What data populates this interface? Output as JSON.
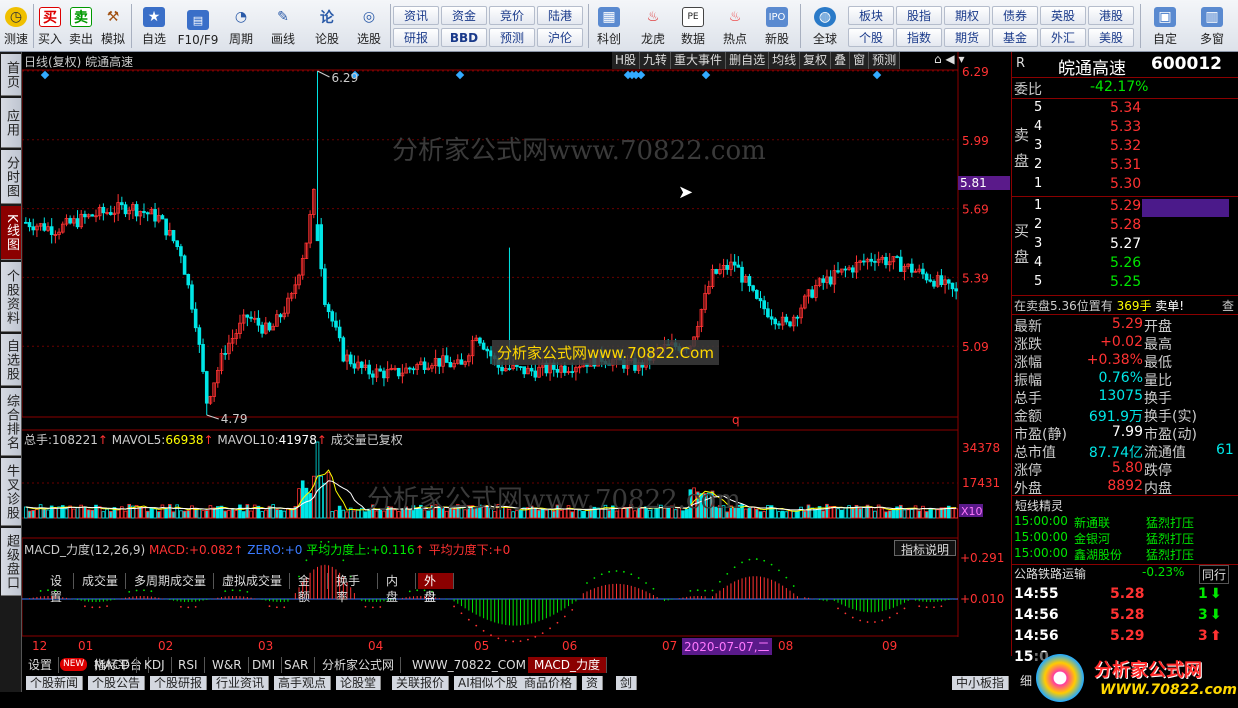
{
  "toolbar": {
    "icons": [
      {
        "label": "测速",
        "icon": "clock-icon"
      },
      {
        "label": "买入",
        "icon": "buy-icon"
      },
      {
        "label": "卖出",
        "icon": "sell-icon"
      },
      {
        "label": "模拟",
        "icon": "hammer-icon"
      },
      {
        "label": "自选",
        "icon": "star-icon"
      },
      {
        "label": "F10/F9",
        "icon": "f10-icon"
      },
      {
        "label": "周期",
        "icon": "period-icon"
      },
      {
        "label": "画线",
        "icon": "pencil-icon"
      },
      {
        "label": "论股",
        "icon": "discuss-icon"
      },
      {
        "label": "选股",
        "icon": "select-icon"
      }
    ],
    "grid": [
      [
        "资讯",
        "资金",
        "竞价",
        "陆港"
      ],
      [
        "研报",
        "BBD",
        "预测",
        "沪伦"
      ]
    ],
    "icons2": [
      {
        "label": "科创",
        "icon": "kechuang-icon"
      },
      {
        "label": "龙虎",
        "icon": "dragon-icon"
      },
      {
        "label": "数据",
        "icon": "pe-icon"
      },
      {
        "label": "热点",
        "icon": "hot-icon"
      },
      {
        "label": "新股",
        "icon": "ipo-icon"
      },
      {
        "label": "全球",
        "icon": "globe-icon"
      }
    ],
    "grid2": [
      [
        "板块",
        "股指",
        "期权",
        "债券",
        "英股",
        "港股"
      ],
      [
        "个股",
        "指数",
        "期货",
        "基金",
        "外汇",
        "美股"
      ]
    ],
    "right": [
      {
        "label": "自定",
        "icon": "custom-icon"
      },
      {
        "label": "多窗",
        "icon": "multiwindow-icon"
      }
    ]
  },
  "left_tabs": [
    "首页",
    "应用",
    "分时图",
    "K线图",
    "个股资料",
    "自选股",
    "综合排名",
    "牛叉诊股",
    "超级盘口"
  ],
  "chart_header": {
    "title": "日线(复权) 皖通高速",
    "buttons": [
      "H股",
      "九转",
      "重大事件",
      "删自选",
      "均线",
      "复权",
      "叠",
      "窗",
      "预测"
    ]
  },
  "watermark": "分析家公式网www.70822.com",
  "watermark_box": "分析家公式网www.70822.Com",
  "price_axis": [
    "6.29",
    "5.99",
    "5.69",
    "5.39",
    "5.09"
  ],
  "price_marker": "5.81",
  "annotations": {
    "high": "6.29",
    "low": "4.79",
    "q": "q"
  },
  "volume": {
    "label": "总手:",
    "total": "108221",
    "mavol5_label": "MAVOL5:",
    "mavol5": "66938",
    "mavol10_label": "MAVOL10:",
    "mavol10": "41978",
    "note": "成交量已复权",
    "axis": [
      "34378",
      "17431"
    ],
    "unit": "X10"
  },
  "vol_tabs": [
    "设置",
    "成交量",
    "多周期成交量",
    "虚拟成交量",
    "金额",
    "换手率",
    "内盘",
    "外盘"
  ],
  "macd": {
    "name": "MACD_力度(12,26,9)",
    "macd_label": "MACD:",
    "macd": "+0.082",
    "zero_label": "ZERO:",
    "zero": "+0",
    "up_label": "平均力度上:",
    "up": "+0.116",
    "down_label": "平均力度下:",
    "down": "+0",
    "axis": [
      "+0.291",
      "+0.010"
    ],
    "button": "指标说明"
  },
  "months": [
    "12",
    "01",
    "02",
    "03",
    "04",
    "05",
    "06",
    "07",
    "08",
    "09"
  ],
  "date_tag": "2020-07-07,二",
  "bottom_tabs": [
    "设置",
    "NEW",
    "指标平台",
    "MACD",
    "KDJ",
    "RSI",
    "W&R",
    "DMI",
    "SAR",
    "分析家公式网",
    "WWW_70822_COM",
    "MACD_力度"
  ],
  "bottom_tabs2": [
    "个股新闻",
    "个股公告",
    "个股研报",
    "行业资讯",
    "高手观点",
    "论股堂",
    "关联报价",
    "AI相似个股",
    "商品价格",
    "资",
    "剑",
    "中小板指"
  ],
  "stock": {
    "r": "R",
    "name": "皖通高速",
    "code": "600012"
  },
  "weibi": {
    "label": "委比",
    "value": "-42.17%"
  },
  "sell": [
    {
      "n": "5",
      "p": "5.34"
    },
    {
      "n": "4",
      "p": "5.33"
    },
    {
      "n": "3",
      "p": "5.32"
    },
    {
      "n": "2",
      "p": "5.31"
    },
    {
      "n": "1",
      "p": "5.30"
    }
  ],
  "buy": [
    {
      "n": "1",
      "p": "5.29"
    },
    {
      "n": "2",
      "p": "5.28"
    },
    {
      "n": "3",
      "p": "5.27"
    },
    {
      "n": "4",
      "p": "5.26"
    },
    {
      "n": "5",
      "p": "5.25"
    }
  ],
  "sell_label": [
    "卖",
    "盘"
  ],
  "buy_label": [
    "买",
    "盘"
  ],
  "msg": {
    "a": "在卖盘5.36位置有",
    "b": "369手",
    "c": "卖单!",
    "d": "查"
  },
  "stats": [
    [
      "最新",
      "5.29",
      "开盘",
      ""
    ],
    [
      "涨跌",
      "+0.02",
      "最高",
      ""
    ],
    [
      "涨幅",
      "+0.38%",
      "最低",
      ""
    ],
    [
      "振幅",
      "0.76%",
      "量比",
      ""
    ],
    [
      "总手",
      "13075",
      "换手",
      ""
    ],
    [
      "金额",
      "691.9万",
      "换手(实)",
      ""
    ],
    [
      "市盈(静)",
      "7.99",
      "市盈(动)",
      ""
    ],
    [
      "总市值",
      "87.74亿",
      "流通值",
      "61"
    ],
    [
      "涨停",
      "5.80",
      "跌停",
      ""
    ],
    [
      "外盘",
      "8892",
      "内盘",
      ""
    ]
  ],
  "jingling": {
    "title": "短线精灵",
    "rows": [
      [
        "15:00:00",
        "新通联",
        "猛烈打压"
      ],
      [
        "15:00:00",
        "金银河",
        "猛烈打压"
      ],
      [
        "15:00:00",
        "鑫湖股份",
        "猛烈打压"
      ]
    ]
  },
  "ticker": {
    "name": "公路铁路运输",
    "change": "-0.23%",
    "btn": "同行"
  },
  "ticks": [
    [
      "14:55",
      "5.28",
      "1"
    ],
    [
      "14:56",
      "5.28",
      "3"
    ],
    [
      "14:56",
      "5.29",
      "3"
    ],
    [
      "15:0",
      "",
      ""
    ]
  ],
  "logo": {
    "text": "分析家公式网",
    "url": "WWW.70822.com"
  },
  "bottom_right": "细"
}
